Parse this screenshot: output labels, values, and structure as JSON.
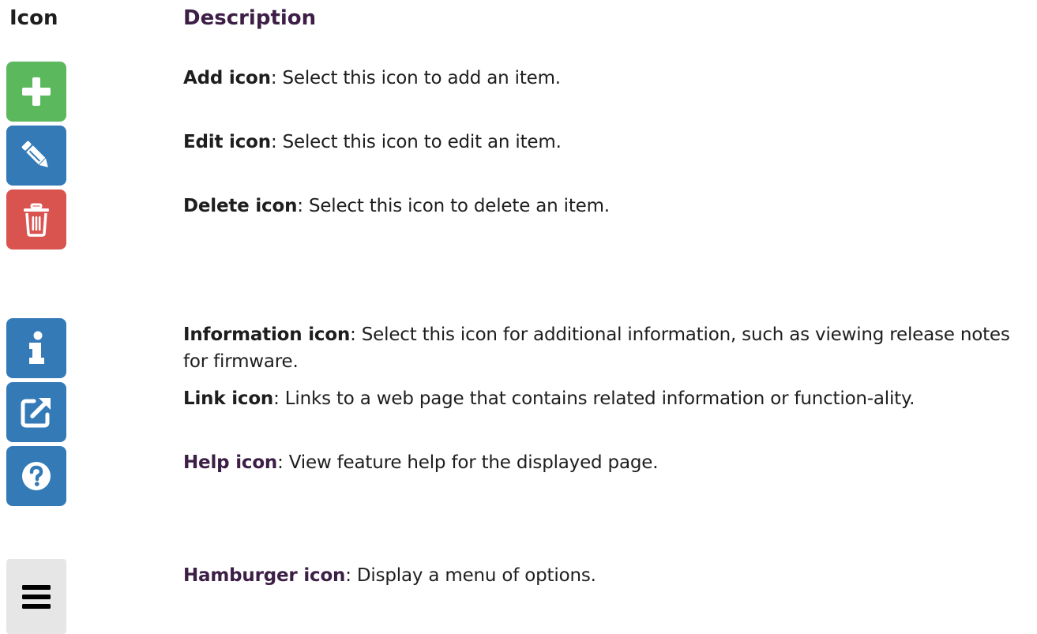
{
  "header": {
    "icon": "Icon",
    "description": "Description"
  },
  "rows": [
    {
      "icon": "plus-icon",
      "color": "#5cb85c",
      "term": "Add icon",
      "text": ": Select this icon to add an item."
    },
    {
      "icon": "pencil-icon",
      "color": "#337ab7",
      "term": "Edit icon",
      "text": ": Select this icon to edit an item."
    },
    {
      "icon": "trash-icon",
      "color": "#d9534f",
      "term": "Delete icon",
      "text": ": Select this icon to delete an item."
    },
    {
      "icon": "info-icon",
      "color": "#337ab7",
      "term": "Information icon",
      "text": ": Select this icon for additional information, such as viewing release notes for firmware."
    },
    {
      "icon": "external-link-icon",
      "color": "#337ab7",
      "term": "Link icon",
      "text": ": Links to a web page that contains related information or function-ality."
    },
    {
      "icon": "question-icon",
      "color": "#337ab7",
      "term": "Help icon",
      "text": ": View feature help for the displayed page."
    },
    {
      "icon": "hamburger-icon",
      "color": "#e6e6e6",
      "term": "Hamburger icon",
      "text": ": Display a menu of options."
    }
  ]
}
